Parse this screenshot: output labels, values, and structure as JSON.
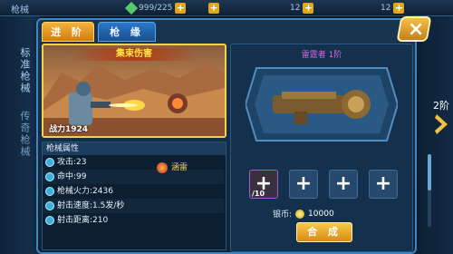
{
  "header": {
    "title": "枪械",
    "res1": "999/225",
    "res2": "12",
    "res3": "12"
  },
  "side_tabs": [
    "标准枪械",
    "传奇枪械"
  ],
  "tabs": {
    "advance": "进 阶",
    "fate": "枪 缘"
  },
  "battle": {
    "banner": "集束伤害",
    "power": "战力1924"
  },
  "stats": {
    "header": "枪械属性",
    "rows": [
      "攻击:23",
      "命中:99",
      "枪械火力:2436",
      "射击速度:1.5发/秒",
      "射击距离:210"
    ],
    "skill": "涵雷"
  },
  "gun": {
    "name": "雷霆者 1阶",
    "material_count": "/10",
    "coin_label": "银币:",
    "coin_value": "10000",
    "synth_label": "合 成"
  },
  "side": {
    "rank": "2阶"
  },
  "colors": {
    "accent": "#3d86c2",
    "gold": "#f4b23c",
    "purple": "#d56ae8"
  }
}
